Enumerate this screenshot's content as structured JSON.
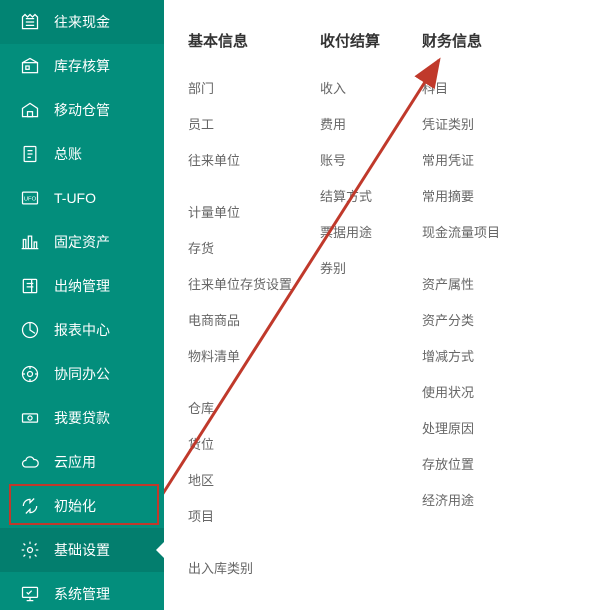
{
  "sidebar": {
    "items": [
      {
        "label": "往来现金",
        "icon": "cash"
      },
      {
        "label": "库存核算",
        "icon": "inventory"
      },
      {
        "label": "移动仓管",
        "icon": "mobile-wh"
      },
      {
        "label": "总账",
        "icon": "ledger"
      },
      {
        "label": "T-UFO",
        "icon": "ufo"
      },
      {
        "label": "固定资产",
        "icon": "asset"
      },
      {
        "label": "出纳管理",
        "icon": "cashier"
      },
      {
        "label": "报表中心",
        "icon": "report"
      },
      {
        "label": "协同办公",
        "icon": "collab"
      },
      {
        "label": "我要贷款",
        "icon": "loan"
      },
      {
        "label": "云应用",
        "icon": "cloud"
      },
      {
        "label": "初始化",
        "icon": "init"
      },
      {
        "label": "基础设置",
        "icon": "settings",
        "active": true
      },
      {
        "label": "系统管理",
        "icon": "system"
      }
    ]
  },
  "columns": [
    {
      "header": "基本信息",
      "items": [
        "部门",
        "员工",
        "往来单位",
        "",
        "计量单位",
        "存货",
        "往来单位存货设置",
        "电商商品",
        "物料清单",
        "",
        "仓库",
        "货位",
        "地区",
        "项目",
        "",
        "出入库类别"
      ]
    },
    {
      "header": "收付结算",
      "items": [
        "收入",
        "费用",
        "账号",
        "结算方式",
        "票据用途",
        "券别"
      ]
    },
    {
      "header": "财务信息",
      "items": [
        "科目",
        "凭证类别",
        "常用凭证",
        "常用摘要",
        "现金流量项目",
        "",
        "资产属性",
        "资产分类",
        "增减方式",
        "使用状况",
        "处理原因",
        "存放位置",
        "经济用途"
      ]
    }
  ],
  "colors": {
    "brand": "#038e7c",
    "highlight": "#c0392b"
  }
}
